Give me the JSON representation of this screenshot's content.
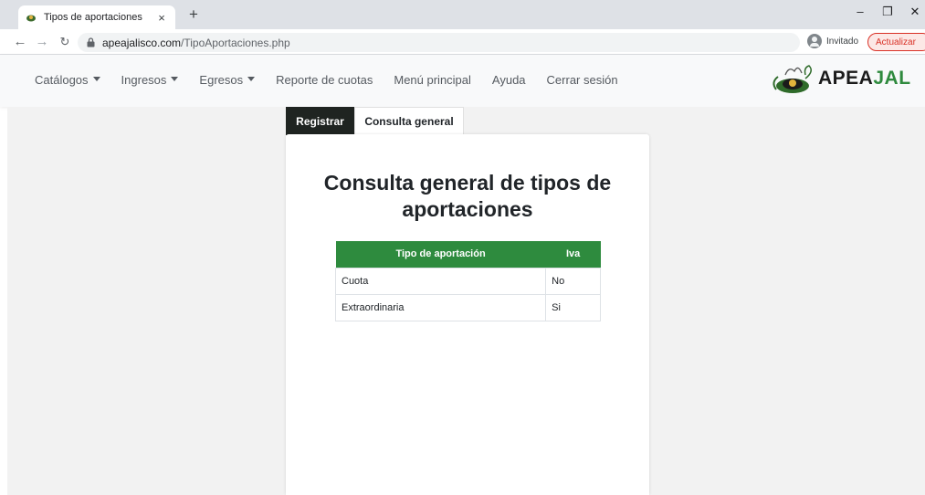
{
  "browser": {
    "tab_title": "Tipos de aportaciones",
    "tab_close": "×",
    "new_tab": "+",
    "url_host": "apeajalisco.com",
    "url_path": "/TipoAportaciones.php",
    "profile_label": "Invitado",
    "update_label": "Actualizar",
    "window_controls": {
      "minimize": "–",
      "maximize": "❐",
      "close": "✕"
    }
  },
  "nav": {
    "items": [
      {
        "label": "Catálogos",
        "dropdown": true
      },
      {
        "label": "Ingresos",
        "dropdown": true
      },
      {
        "label": "Egresos",
        "dropdown": true
      },
      {
        "label": "Reporte de cuotas",
        "dropdown": false
      },
      {
        "label": "Menú principal",
        "dropdown": false
      },
      {
        "label": "Ayuda",
        "dropdown": false
      },
      {
        "label": "Cerrar sesión",
        "dropdown": false
      }
    ],
    "brand_main": "APEA",
    "brand_accent": "JAL"
  },
  "tabs": {
    "register": "Registrar",
    "query": "Consulta general"
  },
  "card": {
    "title": "Consulta general de tipos de aportaciones",
    "table": {
      "headers": [
        "Tipo de aportación",
        "Iva"
      ],
      "rows": [
        [
          "Cuota",
          "No"
        ],
        [
          "Extraordinaria",
          "Si"
        ]
      ]
    }
  },
  "colors": {
    "header_green": "#2e8b3e",
    "tab_dark": "#1f2421",
    "update_red": "#d93025"
  },
  "icons": [
    "favicon-icon",
    "back-arrow-icon",
    "forward-arrow-icon",
    "reload-icon",
    "lock-icon",
    "profile-icon",
    "kebab-menu-icon",
    "apeajal-logo-icon"
  ]
}
